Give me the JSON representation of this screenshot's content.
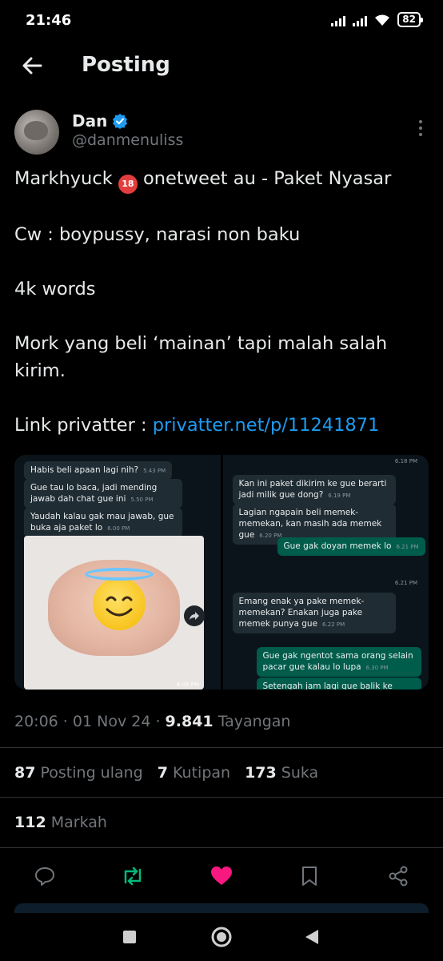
{
  "status_bar": {
    "time": "21:46",
    "battery": "82"
  },
  "header": {
    "title": "Posting"
  },
  "post": {
    "author_name": "Dan",
    "author_handle": "@danmenuliss",
    "verified": true,
    "text_line1_before": "Markhyuck ",
    "age_emoji": "18",
    "text_line1_after": " onetweet au - Paket Nyasar",
    "text_line2": "Cw : boypussy, narasi non baku",
    "text_line3": "4k words",
    "text_line4": "Mork yang beli ‘mainan’ tapi malah salah kirim.",
    "link_prefix": "Link privatter : ",
    "link_text": "privatter.net/p/11241871",
    "time": "20:06",
    "date": "01 Nov 24",
    "views_count": "9.841",
    "views_label": "Tayangan",
    "reposts_count": "87",
    "reposts_label": "Posting ulang",
    "quotes_count": "7",
    "quotes_label": "Kutipan",
    "likes_count": "173",
    "likes_label": "Suka",
    "bookmarks_count": "112",
    "bookmarks_label": "Markah",
    "liked": true
  },
  "media": {
    "left": {
      "messages": [
        {
          "text": "Habis beli apaan lagi nih?",
          "time": "5.43 PM"
        },
        {
          "text": "Gue tau lo baca, jadi mending jawab dah chat gue ini",
          "time": "5.50 PM"
        },
        {
          "text": "Yaudah kalau gak mau jawab, gue buka aja paket lo",
          "time": "6.00 PM"
        }
      ],
      "photo_time": "6.05 PM"
    },
    "right": {
      "messages": [
        {
          "text": "Kan ini paket dikirim ke gue berarti jadi milik gue dong?",
          "time": "6.19 PM",
          "out": false
        },
        {
          "text": "Lagian ngapain beli memek-memekan, kan masih ada memek gue",
          "time": "6.20 PM",
          "out": false
        },
        {
          "text": "Gue gak doyan memek lo",
          "time": "6.21 PM",
          "out": true
        },
        {
          "text": "Emang enak ya pake memek-memekan? Enakan juga pake memek punya gue",
          "time": "6.22 PM",
          "out": false
        },
        {
          "text": "Gue gak ngentot sama orang selain pacar gue kalau lo lupa",
          "time": "6.30 PM",
          "out": true
        },
        {
          "text": "Setengah jam lagi gue balik ke kosan.",
          "time": "",
          "out": true
        }
      ],
      "top_time_1": "6.18 PM",
      "top_time_2": "6.21 PM"
    }
  },
  "colors": {
    "accent": "#1d9bf0",
    "like": "#f91880",
    "repost": "#00ba7c",
    "secondary": "#71767b"
  }
}
